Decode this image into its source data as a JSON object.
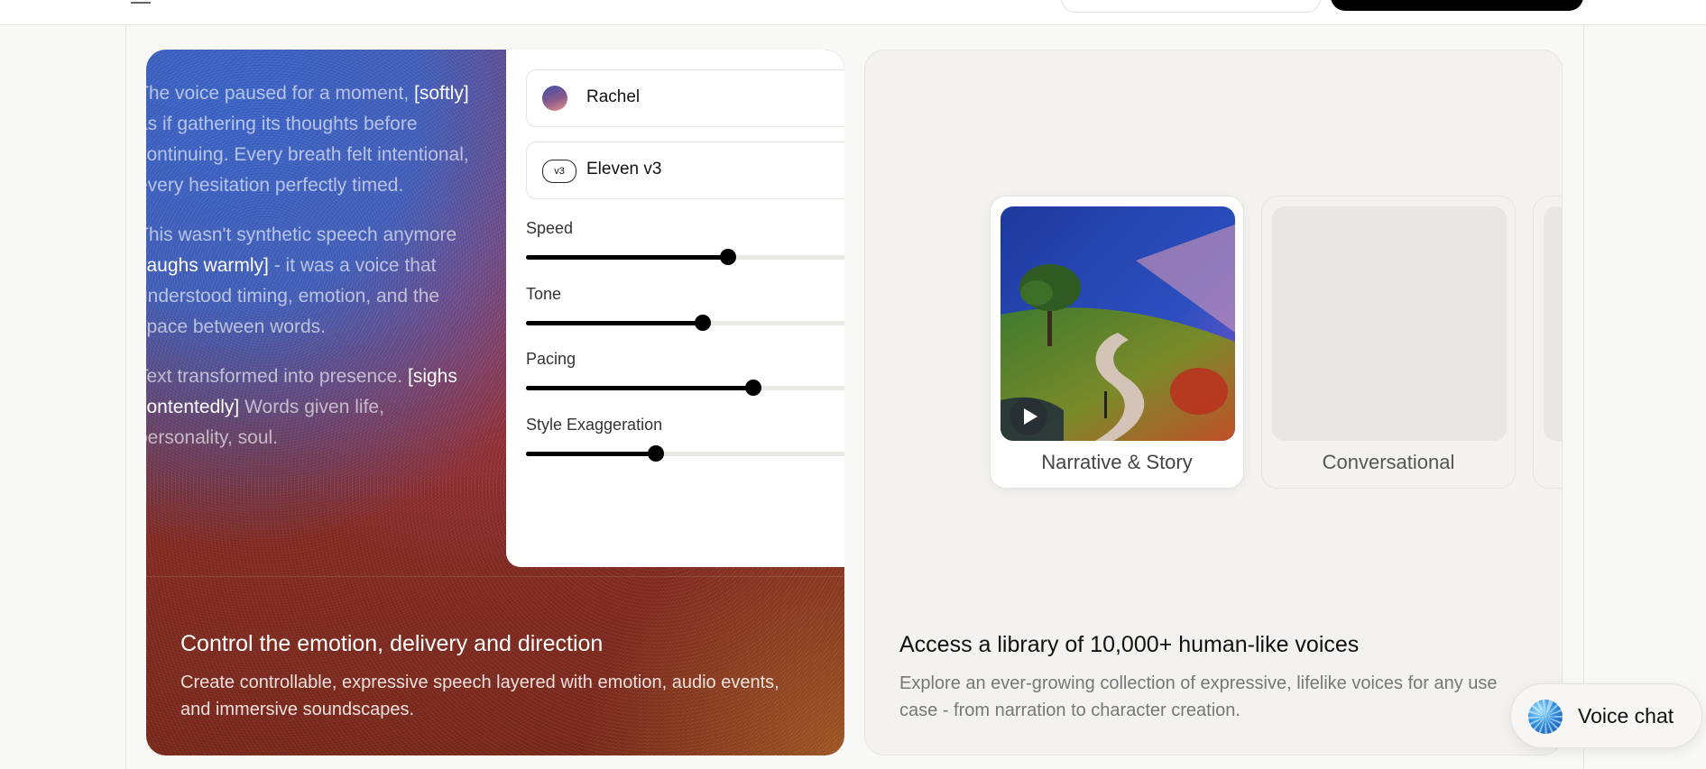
{
  "story": {
    "paragraphs": [
      [
        {
          "t": "The voice paused for a moment, ",
          "tag": false
        },
        {
          "t": "[softly]",
          "tag": true
        },
        {
          "t": "\nas if gathering its thoughts before\ncontinuing. Every breath felt intentional,\nevery hesitation perfectly timed.",
          "tag": false
        }
      ],
      [
        {
          "t": "This wasn't synthetic speech anymore\n",
          "tag": false
        },
        {
          "t": "[laughs warmly]",
          "tag": true
        },
        {
          "t": " - it was a voice that\nunderstood timing, emotion, and the\nspace between words.",
          "tag": false
        }
      ],
      [
        {
          "t": "Text transformed into presence. ",
          "tag": false
        },
        {
          "t": "[sighs\ncontentedly]",
          "tag": true
        },
        {
          "t": " Words given life,\npersonality, soul.",
          "tag": false
        }
      ]
    ]
  },
  "settings": {
    "voice_name": "Rachel",
    "model_badge": "v3",
    "model_name": "Eleven v3",
    "sliders": [
      {
        "label": "Speed",
        "value": 0.56
      },
      {
        "label": "Tone",
        "value": 0.49
      },
      {
        "label": "Pacing",
        "value": 0.63
      },
      {
        "label": "Style Exaggeration",
        "value": 0.36
      }
    ]
  },
  "features": {
    "emotion": {
      "title": "Control the emotion, delivery and direction",
      "description": "Create controllable, expressive speech layered with emotion, audio events, and immersive soundscapes."
    },
    "library": {
      "title": "Access a library of 10,000+ human-like voices",
      "description": "Explore an ever-growing collection of expressive, lifelike voices for any use case - from narration to character creation.",
      "tiles": [
        {
          "label": "Narrative & Story"
        },
        {
          "label": "Conversational"
        },
        {
          "label": ""
        }
      ]
    }
  },
  "voice_chat": {
    "label": "Voice chat"
  }
}
